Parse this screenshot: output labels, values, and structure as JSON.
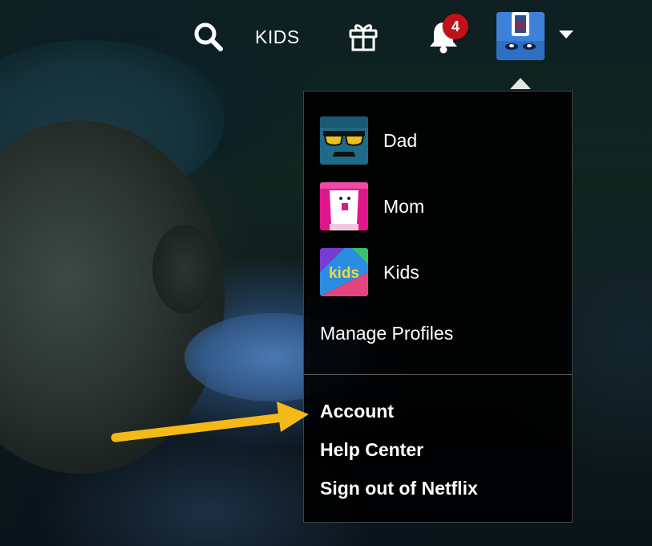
{
  "header": {
    "kids_label": "KIDS",
    "notification_count": "4"
  },
  "profile_menu": {
    "profiles": [
      {
        "name": "Dad"
      },
      {
        "name": "Mom"
      },
      {
        "name": "Kids"
      }
    ],
    "kids_thumb_text": "kids",
    "manage_profiles_label": "Manage Profiles",
    "links": {
      "account": "Account",
      "help_center": "Help Center",
      "sign_out": "Sign out of Netflix"
    }
  },
  "avatar_letter": "N",
  "colors": {
    "badge": "#c11119",
    "annotation_arrow": "#f5b918",
    "menu_background": "#000000",
    "avatar_blue": "#3c82d8"
  }
}
